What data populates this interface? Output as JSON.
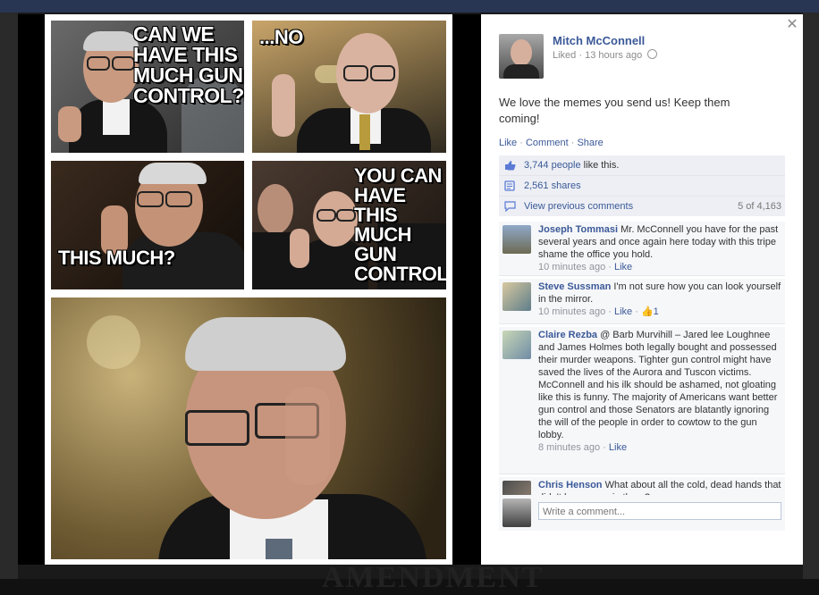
{
  "background": {
    "bottom_text": "AMENDMENT"
  },
  "photo": {
    "panels": [
      {
        "caption": "CAN WE HAVE THIS MUCH GUN CONTROL?"
      },
      {
        "caption": "...NO"
      },
      {
        "caption": "THIS MUCH?"
      },
      {
        "caption": "YOU CAN HAVE THIS MUCH GUN CONTROL"
      }
    ]
  },
  "post": {
    "author": "Mitch McConnell",
    "meta": "Liked · 13 hours ago",
    "privacy_icon": "globe-icon",
    "message": "We love the memes you send us! Keep them coming!",
    "actions": {
      "like": "Like",
      "comment": "Comment",
      "share": "Share",
      "separator": " · "
    }
  },
  "ufi": {
    "likes_count": "3,744 people",
    "likes_suffix": " like this.",
    "shares": "2,561 shares",
    "view_previous": "View previous comments",
    "pager": "5 of 4,163"
  },
  "comments": [
    {
      "name": "Joseph Tommasi",
      "text": " Mr. McConnell you have for the past several years and once again here today with this tripe shame the office you hold.",
      "time": "10 minutes ago",
      "like": "Like",
      "likes": ""
    },
    {
      "name": "Steve Sussman",
      "text": " I'm not sure how you can look yourself in the mirror.",
      "time": "10 minutes ago",
      "like": "Like",
      "likes": "1"
    },
    {
      "name": "Claire Rezba",
      "text": " @ Barb Murvihill – Jared lee Loughnee and James Holmes both legally bought and possessed their murder weapons. Tighter gun control might have saved the lives of the Aurora and Tuscon victims. McConnell and his ilk should be ashamed, not gloating like this is funny. The majority of Americans want better gun control and those Senators are blatantly ignoring the will of the people in order to cowtow to the gun lobby.",
      "time": "8 minutes ago",
      "like": "Like",
      "likes": ""
    },
    {
      "name": "Chris Henson",
      "text": " What about all the cold, dead hands that didn't have guns in them?",
      "time": "",
      "like": "",
      "likes": ""
    }
  ],
  "composer": {
    "placeholder": "Write a comment..."
  },
  "colors": {
    "fb_blue": "#3b5998",
    "ufi_bg": "#edeff4"
  }
}
